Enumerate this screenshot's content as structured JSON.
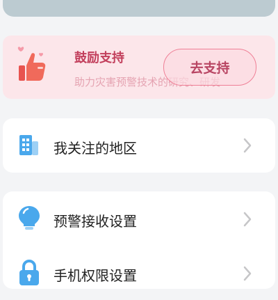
{
  "support": {
    "title": "鼓励支持",
    "subtitle": "助力灾害预警技术的研究、研发",
    "button_label": "去支持"
  },
  "settings": {
    "group1": [
      {
        "label": "我关注的地区",
        "icon": "building-icon"
      }
    ],
    "group2": [
      {
        "label": "预警接收设置",
        "icon": "lightbulb-icon"
      },
      {
        "label": "手机权限设置",
        "icon": "lock-icon"
      }
    ]
  },
  "colors": {
    "accent_pink": "#c23f5c",
    "icon_blue": "#4aa8ec",
    "card_pink_bg": "#fce6ea"
  }
}
